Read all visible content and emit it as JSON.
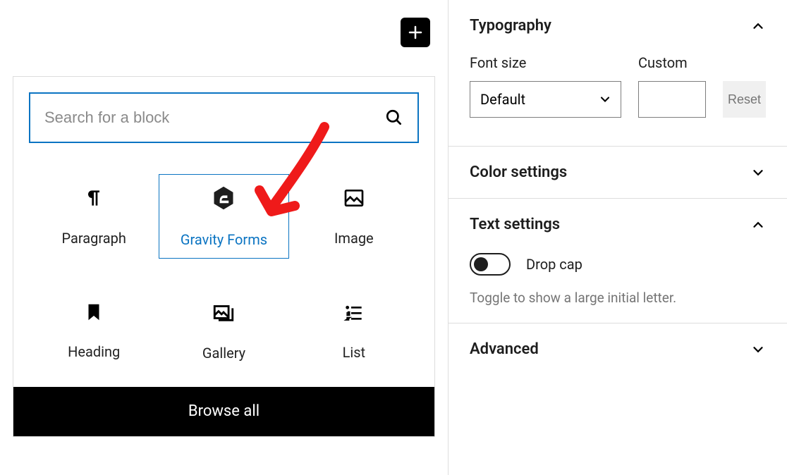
{
  "inserter": {
    "search_placeholder": "Search for a block",
    "blocks": [
      {
        "label": "Paragraph"
      },
      {
        "label": "Gravity Forms"
      },
      {
        "label": "Image"
      },
      {
        "label": "Heading"
      },
      {
        "label": "Gallery"
      },
      {
        "label": "List"
      }
    ],
    "browse_all": "Browse all"
  },
  "sidebar": {
    "typography": {
      "title": "Typography",
      "font_size_label": "Font size",
      "font_size_value": "Default",
      "custom_label": "Custom",
      "custom_value": "",
      "reset_label": "Reset"
    },
    "color": {
      "title": "Color settings"
    },
    "text": {
      "title": "Text settings",
      "dropcap_label": "Drop cap",
      "dropcap_desc": "Toggle to show a large initial letter."
    },
    "advanced": {
      "title": "Advanced"
    }
  }
}
